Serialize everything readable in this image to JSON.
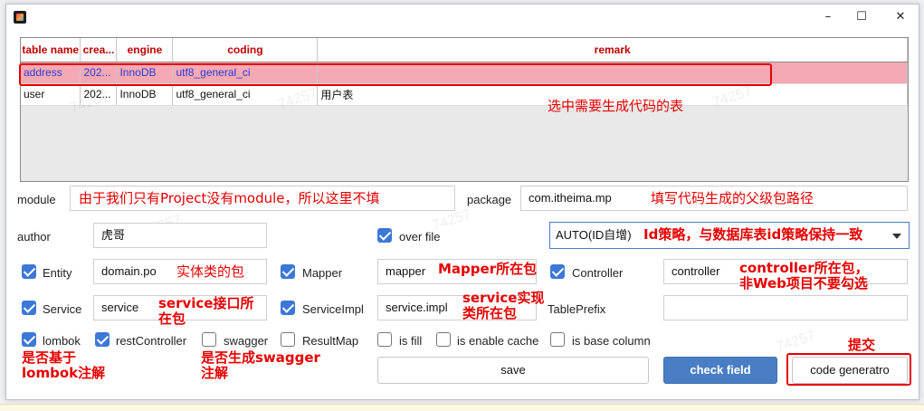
{
  "window": {
    "minimize": "–",
    "maximize": "☐",
    "close": "✕"
  },
  "grid": {
    "columns": [
      "table name",
      "crea...",
      "engine",
      "coding",
      "remark"
    ],
    "rows": [
      [
        "address",
        "202...",
        "InnoDB",
        "utf8_general_ci",
        ""
      ],
      [
        "user",
        "202...",
        "InnoDB",
        "utf8_general_ci",
        "用户表"
      ]
    ]
  },
  "annotations": {
    "select_table": "选中需要生成代码的表",
    "module_note": "由于我们只有Project没有module，所以这里不填",
    "package_note": "填写代码生成的父级包路径",
    "id_note": "Id策略，与数据库表id策略保持一致",
    "entity_note": "实体类的包",
    "mapper_note": "Mapper所在包",
    "controller_note_1": "controller所在包，",
    "controller_note_2": "非Web项目不要勾选",
    "service_note_1": "service接口所",
    "service_note_2": "在包",
    "impl_note_1": "service实现",
    "impl_note_2": "类所在包",
    "lombok_note_1": "是否基于",
    "lombok_note_2": "lombok注解",
    "swagger_note_1": "是否生成swagger",
    "swagger_note_2": "注解",
    "submit_note": "提交"
  },
  "form": {
    "module_label": "module",
    "package_label": "package",
    "package_value": "com.itheima.mp",
    "author_label": "author",
    "author_value": "虎哥",
    "over_file_label": "over file",
    "id_type_value": "AUTO(ID自增)",
    "entity_label": "Entity",
    "entity_value": "domain.po",
    "mapper_label": "Mapper",
    "mapper_value": "mapper",
    "controller_label": "Controller",
    "controller_value": "controller",
    "service_label": "Service",
    "service_value": "service",
    "serviceimpl_label": "ServiceImpl",
    "serviceimpl_value": "service.impl",
    "table_prefix_label": "TablePrefix",
    "table_prefix_value": "",
    "lombok_label": "lombok",
    "rest_controller_label": "restController",
    "swagger_label": "swagger",
    "result_map_label": "ResultMap",
    "is_fill_label": "is fill",
    "is_enable_cache_label": "is enable cache",
    "is_base_column_label": "is base column"
  },
  "buttons": {
    "save": "save",
    "check_field": "check field",
    "code_generator": "code generatro"
  },
  "colors": {
    "accent_blue": "#4a7ec4",
    "annotation_red": "#e60000",
    "selected_row": "#f5a9b4"
  }
}
